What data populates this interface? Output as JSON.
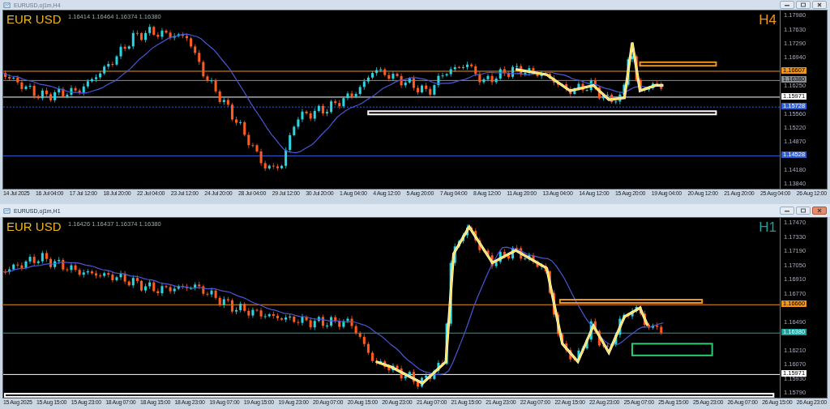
{
  "windows": [
    {
      "title": "EURUSD,oj1m,H4",
      "active": false,
      "symbol": "EUR USD",
      "ohlc": "1.16414 1.16464 1.16374 1.16380",
      "timeframe": "H4",
      "color": "#f0941c",
      "price_ticks": [
        "1.17980",
        "1.17630",
        "1.17290",
        "1.16940",
        "1.16250",
        "1.15560",
        "1.15220",
        "1.14870",
        "1.14180",
        "1.13840"
      ],
      "price_tags": [
        {
          "label": "1.16607",
          "color": "#f0941c",
          "kind": "solid"
        },
        {
          "label": "1.16380",
          "color": "#8a8f96",
          "kind": "solid"
        },
        {
          "label": "1.15971",
          "color": "#ffffff",
          "kind": "solid"
        },
        {
          "label": "1.15728",
          "color": "#2f5fd0",
          "kind": "dotted"
        },
        {
          "label": "1.14528",
          "color": "#2f5fd0",
          "kind": "solid"
        }
      ],
      "time_labels": [
        "14 Jul 2025",
        "16 Jul 04:00",
        "17 Jul 12:00",
        "18 Jul 20:00",
        "22 Jul 04:00",
        "23 Jul 12:00",
        "24 Jul 20:00",
        "28 Jul 04:00",
        "29 Jul 12:00",
        "30 Jul 20:00",
        "1 Aug 04:00",
        "4 Aug 12:00",
        "5 Aug 20:00",
        "7 Aug 04:00",
        "8 Aug 12:00",
        "11 Aug 20:00",
        "13 Aug 04:00",
        "14 Aug 12:00",
        "15 Aug 20:00",
        "19 Aug 04:00",
        "20 Aug 12:00",
        "21 Aug 20:00",
        "25 Aug 04:00",
        "26 Aug 12:00"
      ]
    },
    {
      "title": "EURUSD,oj1m,H1",
      "active": true,
      "symbol": "EUR USD",
      "ohlc": "1.16426 1.16437 1.16374 1.16380",
      "timeframe": "H1",
      "color": "#1f9e9a",
      "price_ticks": [
        "1.17470",
        "1.17330",
        "1.17190",
        "1.17050",
        "1.16910",
        "1.16770",
        "1.16490",
        "1.16210",
        "1.16070",
        "1.15930",
        "1.15790"
      ],
      "price_tags": [
        {
          "label": "1.16660",
          "color": "#f0941c",
          "kind": "solid"
        },
        {
          "label": "1.16380",
          "color": "#1f9e9a",
          "kind": "solid"
        },
        {
          "label": "1.15971",
          "color": "#ffffff",
          "kind": "solid"
        }
      ],
      "time_labels": [
        "15 Aug 2025",
        "15 Aug 15:00",
        "15 Aug 23:00",
        "18 Aug 07:00",
        "18 Aug 15:00",
        "18 Aug 23:00",
        "19 Aug 07:00",
        "19 Aug 15:00",
        "19 Aug 23:00",
        "20 Aug 07:00",
        "20 Aug 15:00",
        "20 Aug 23:00",
        "21 Aug 07:00",
        "21 Aug 15:00",
        "21 Aug 23:00",
        "22 Aug 07:00",
        "22 Aug 15:00",
        "22 Aug 23:00",
        "25 Aug 07:00",
        "25 Aug 15:00",
        "25 Aug 23:00",
        "26 Aug 07:00",
        "26 Aug 15:00",
        "26 Aug 23:00"
      ]
    }
  ]
}
